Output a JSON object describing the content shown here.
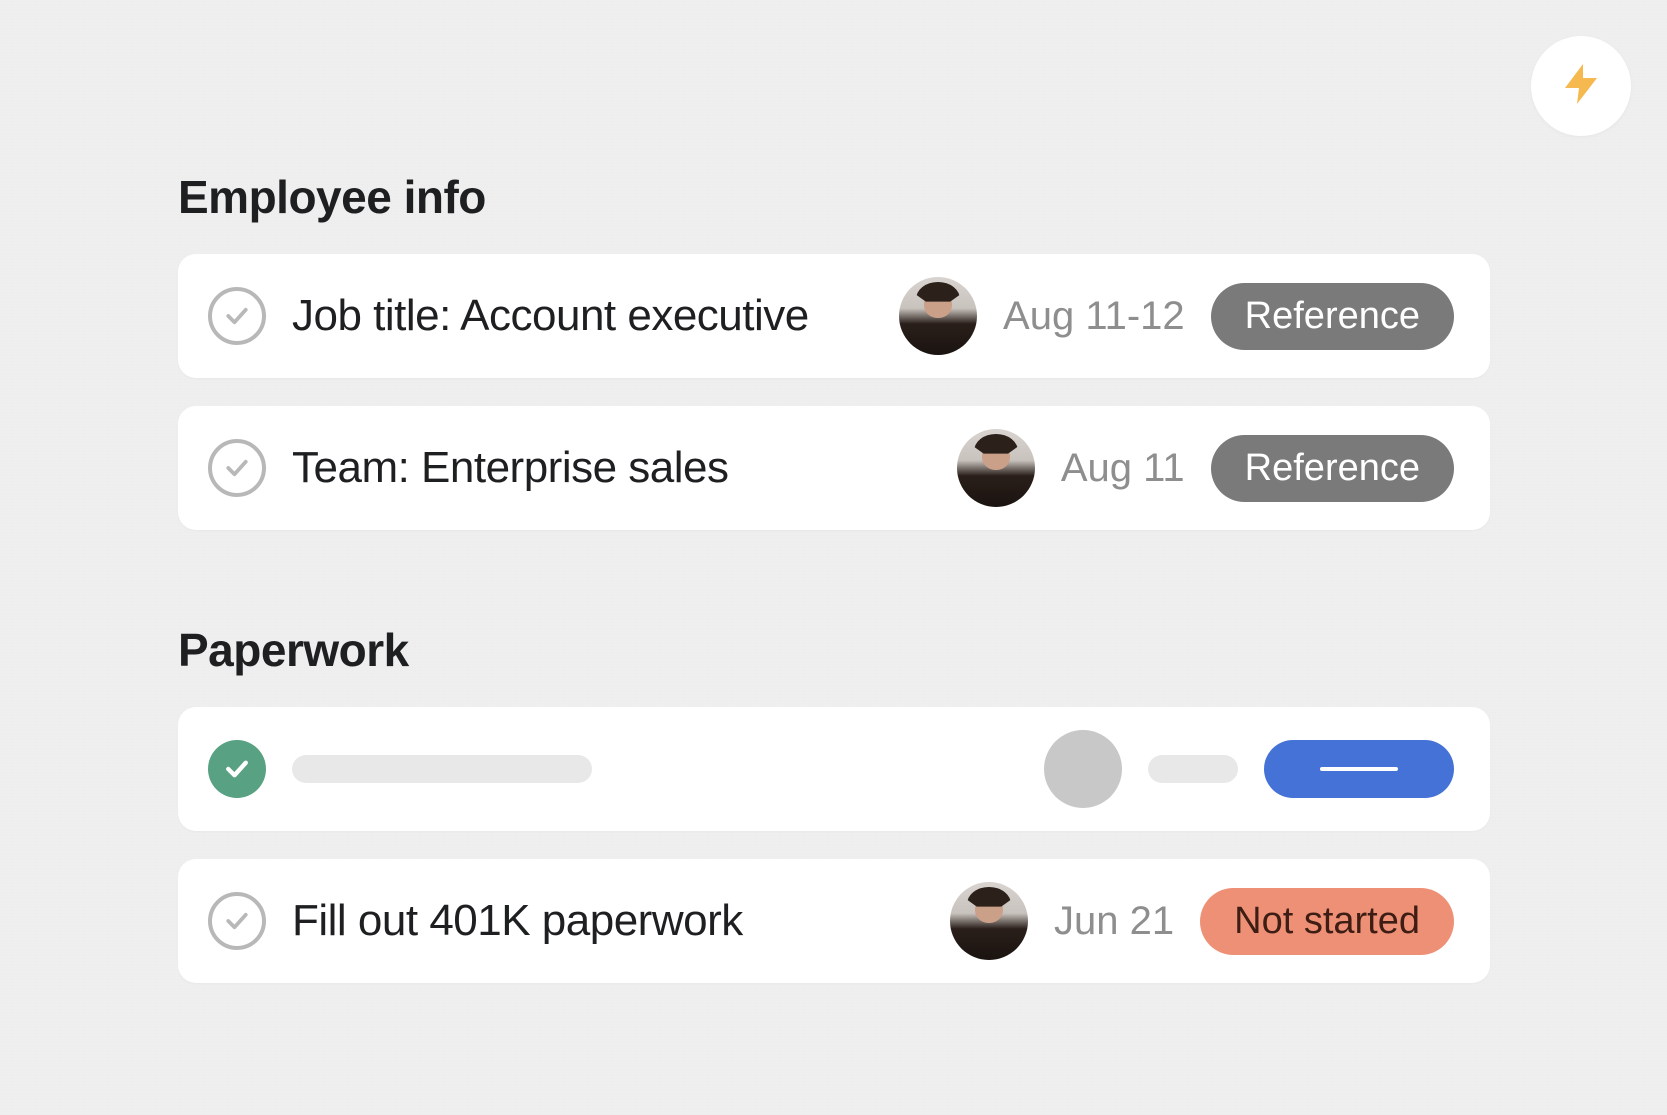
{
  "sections": [
    {
      "title": "Employee info",
      "tasks": [
        {
          "title": "Job title: Account executive",
          "date": "Aug 11-12",
          "tag": {
            "label": "Reference",
            "style": "gray"
          },
          "completed": false,
          "skeleton": false
        },
        {
          "title": "Team: Enterprise sales",
          "date": "Aug 11",
          "tag": {
            "label": "Reference",
            "style": "gray"
          },
          "completed": false,
          "skeleton": false
        }
      ]
    },
    {
      "title": "Paperwork",
      "tasks": [
        {
          "title": "",
          "date": "",
          "tag": {
            "label": "",
            "style": "blue-solid"
          },
          "completed": true,
          "skeleton": true
        },
        {
          "title": "Fill out 401K paperwork",
          "date": "Jun 21",
          "tag": {
            "label": "Not started",
            "style": "orange"
          },
          "completed": false,
          "skeleton": false
        }
      ]
    }
  ]
}
